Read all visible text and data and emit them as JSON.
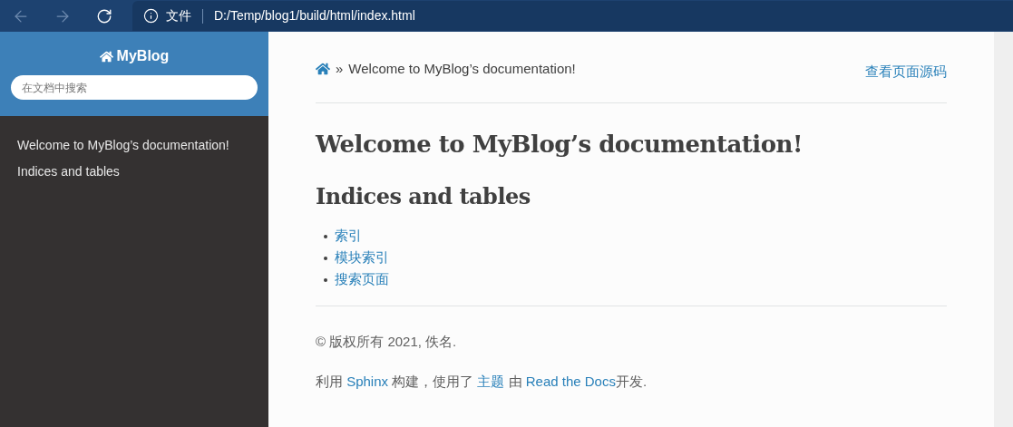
{
  "browser": {
    "security_label": "文件",
    "address": "D:/Temp/blog1/build/html/index.html"
  },
  "sidebar": {
    "project": "MyBlog",
    "search": {
      "placeholder": "在文档中搜索"
    },
    "items": [
      {
        "label": "Welcome to MyBlog’s documentation!"
      },
      {
        "label": "Indices and tables"
      }
    ]
  },
  "breadcrumb": {
    "separator": "»",
    "current": "Welcome to MyBlog’s documentation!"
  },
  "view_source": "查看页面源码",
  "title": "Welcome to MyBlog’s documentation!",
  "section": {
    "heading": "Indices and tables",
    "links": [
      "索引",
      "模块索引",
      "搜索页面"
    ]
  },
  "footer": {
    "copyright": "© 版权所有 2021, 佚名.",
    "credit": [
      {
        "text": "利用 ",
        "link": false
      },
      {
        "text": "Sphinx",
        "link": true
      },
      {
        "text": " 构建，使用了 ",
        "link": false
      },
      {
        "text": "主题",
        "link": true
      },
      {
        "text": " 由 ",
        "link": false
      },
      {
        "text": "Read the Docs",
        "link": true
      },
      {
        "text": "开发.",
        "link": false
      }
    ]
  }
}
